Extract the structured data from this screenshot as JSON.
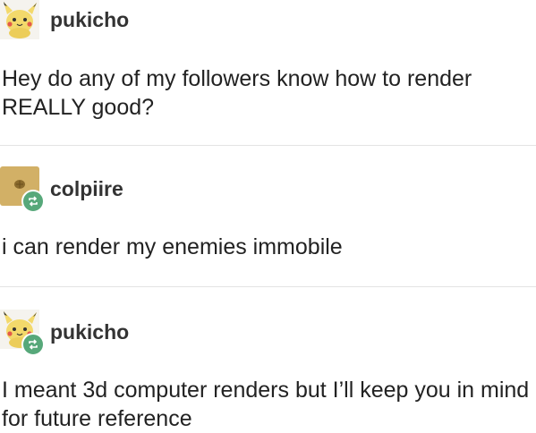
{
  "posts": [
    {
      "username": "pukicho",
      "avatar_icon": "pikachu-plush-icon",
      "text": "Hey do any of my followers know how to render REALLY good?",
      "reblogged": false
    },
    {
      "username": "colpiire",
      "avatar_icon": "tan-photo-avatar-icon",
      "text": "i can render my enemies immobile",
      "reblogged": true
    },
    {
      "username": "pukicho",
      "avatar_icon": "pikachu-plush-icon",
      "text": "I meant 3d computer renders but I’ll keep you in mind for future reference",
      "reblogged": true
    }
  ],
  "colors": {
    "reblog_badge": "#57a87a",
    "divider": "#e3e3e3",
    "pikachu_yellow": "#f3d96b"
  }
}
